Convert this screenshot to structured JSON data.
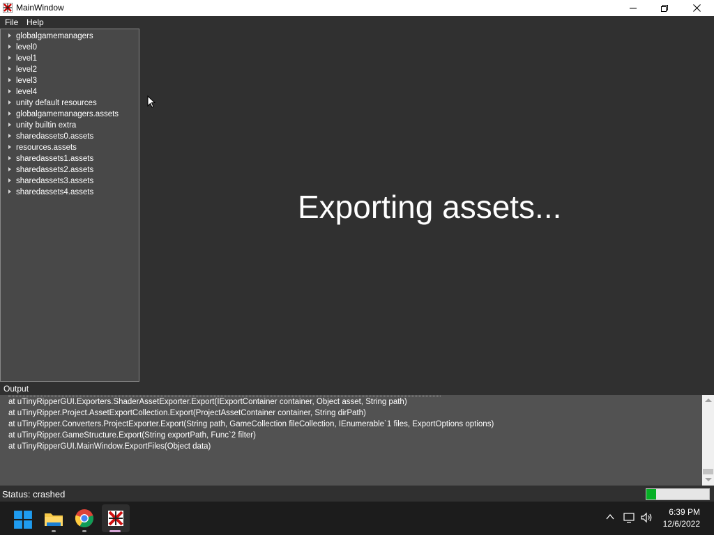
{
  "window": {
    "title": "MainWindow",
    "icon": "utinyripper-icon"
  },
  "menu": {
    "items": [
      {
        "label": "File"
      },
      {
        "label": "Help"
      }
    ]
  },
  "tree": {
    "items": [
      {
        "label": "globalgamemanagers"
      },
      {
        "label": "level0"
      },
      {
        "label": "level1"
      },
      {
        "label": "level2"
      },
      {
        "label": "level3"
      },
      {
        "label": "level4"
      },
      {
        "label": "unity default resources"
      },
      {
        "label": "globalgamemanagers.assets"
      },
      {
        "label": "unity builtin extra"
      },
      {
        "label": "sharedassets0.assets"
      },
      {
        "label": "resources.assets"
      },
      {
        "label": "sharedassets1.assets"
      },
      {
        "label": "sharedassets2.assets"
      },
      {
        "label": "sharedassets3.assets"
      },
      {
        "label": "sharedassets4.assets"
      }
    ]
  },
  "main": {
    "message": "Exporting assets..."
  },
  "output": {
    "label": "Output",
    "lines": [
      "at uTinyRipperGUI.Exporters.ShaderAssetExporter.Export(IExportContainer container, Object asset, String path)",
      "at uTinyRipper.Project.AssetExportCollection.Export(ProjectAssetContainer container, String dirPath)",
      "at uTinyRipper.Converters.ProjectExporter.Export(String path, GameCollection fileCollection, IEnumerable`1 files, ExportOptions options)",
      "at uTinyRipper.GameStructure.Export(String exportPath, Func`2 filter)",
      "at uTinyRipperGUI.MainWindow.ExportFiles(Object data)"
    ]
  },
  "status": {
    "text": "Status: crashed",
    "progress_fraction": 0.15,
    "progress_color": "#06b025"
  },
  "taskbar": {
    "apps": [
      {
        "name": "start",
        "icon": "windows-logo-icon"
      },
      {
        "name": "explorer",
        "icon": "folder-icon"
      },
      {
        "name": "chrome",
        "icon": "chrome-icon"
      },
      {
        "name": "utinyripper",
        "icon": "utinyripper-icon"
      }
    ],
    "time": "6:39 PM",
    "date": "12/6/2022"
  }
}
